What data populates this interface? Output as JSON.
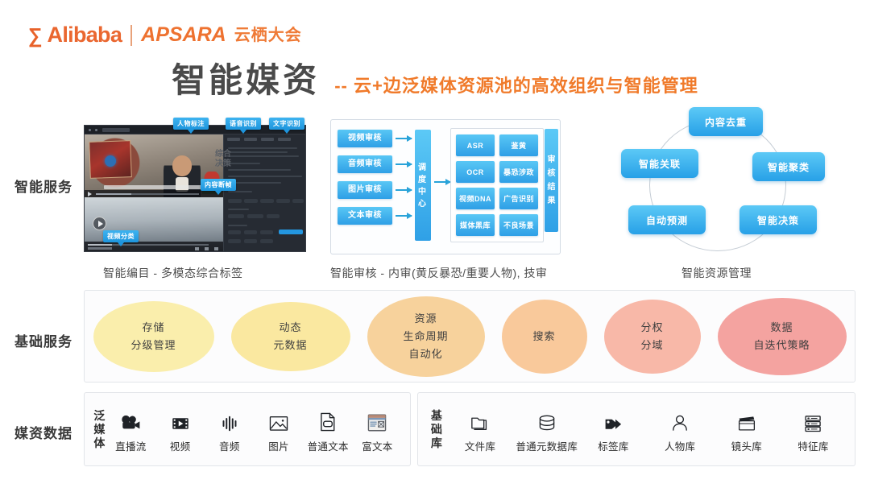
{
  "header": {
    "logo_mark": "ⓦ",
    "brand": "Alibaba",
    "apsara": "APSARA",
    "apsara_cn": "云栖大会",
    "accent_color": "#ef7630"
  },
  "title": {
    "main": "智能媒资",
    "sub": "-- 云+边泛媒体资源池的高效组织与智能管理",
    "main_color": "#4a4a4a",
    "sub_color": "#f07a2a"
  },
  "rows": {
    "intelligent_service": "智能服务",
    "basic_service": "基础服务",
    "media_data": "媒资数据"
  },
  "panel_screenshot": {
    "callouts": {
      "person_tag": "人物标注",
      "speech_recognition": "语音识别",
      "text_recognition": "文字识别",
      "content_frame": "内容断帧",
      "video_classification": "视频分类"
    },
    "caption": "智能编目 - 多模态综合标签"
  },
  "panel_audit": {
    "caption": "智能审核 - 内审(黄反暴恐/重要人物), 技审",
    "sources": [
      "视频审核",
      "音频审核",
      "图片审核",
      "文本审核"
    ],
    "center": [
      "调",
      "度",
      "中",
      "心"
    ],
    "engines": [
      "ASR",
      "鉴黄",
      "OCR",
      "暴恐涉政",
      "视频DNA",
      "广告识别",
      "媒体黑库",
      "不良场景"
    ],
    "decision_label": [
      "综合",
      "决策"
    ],
    "result": [
      "审",
      "核",
      "结",
      "果"
    ]
  },
  "panel_circle": {
    "caption": "智能资源管理",
    "nodes": [
      {
        "id": "dedupe",
        "label": "内容去重"
      },
      {
        "id": "cluster",
        "label": "智能聚类"
      },
      {
        "id": "decide",
        "label": "智能决策"
      },
      {
        "id": "predict",
        "label": "自动预测"
      },
      {
        "id": "relate",
        "label": "智能关联"
      }
    ]
  },
  "basic_services": [
    {
      "lines": [
        "存储",
        "分级管理"
      ],
      "color": "#faeeac",
      "w": 150,
      "h": 88
    },
    {
      "lines": [
        "动态",
        "元数据"
      ],
      "color": "#fae8a0",
      "w": 148,
      "h": 86
    },
    {
      "lines": [
        "资源",
        "生命周期",
        "自动化"
      ],
      "color": "#f7d29c",
      "w": 146,
      "h": 100
    },
    {
      "lines": [
        "搜索"
      ],
      "color": "#f9c99b",
      "w": 106,
      "h": 92
    },
    {
      "lines": [
        "分权",
        "分域"
      ],
      "color": "#f8b8a8",
      "w": 120,
      "h": 92
    },
    {
      "lines": [
        "数据",
        "自迭代策略"
      ],
      "color": "#f4a3a0",
      "w": 160,
      "h": 96
    }
  ],
  "media_groups": [
    {
      "vlabel": [
        "泛",
        "媒",
        "体"
      ],
      "items": [
        {
          "name": "直播流",
          "icon": "movie-camera-icon"
        },
        {
          "name": "视频",
          "icon": "film-play-icon"
        },
        {
          "name": "音频",
          "icon": "audio-waveform-icon"
        },
        {
          "name": "图片",
          "icon": "picture-icon"
        },
        {
          "name": "普通文本",
          "icon": "doc-file-icon"
        },
        {
          "name": "富文本",
          "icon": "rich-text-icon"
        }
      ]
    },
    {
      "vlabel": [
        "基",
        "础",
        "库"
      ],
      "items": [
        {
          "name": "文件库",
          "icon": "folder-icon"
        },
        {
          "name": "普通元数据库",
          "icon": "database-icon"
        },
        {
          "name": "标签库",
          "icon": "tag-icon"
        },
        {
          "name": "人物库",
          "icon": "person-icon"
        },
        {
          "name": "镜头库",
          "icon": "clapperboard-icon"
        },
        {
          "name": "特征库",
          "icon": "server-icon"
        }
      ]
    }
  ]
}
